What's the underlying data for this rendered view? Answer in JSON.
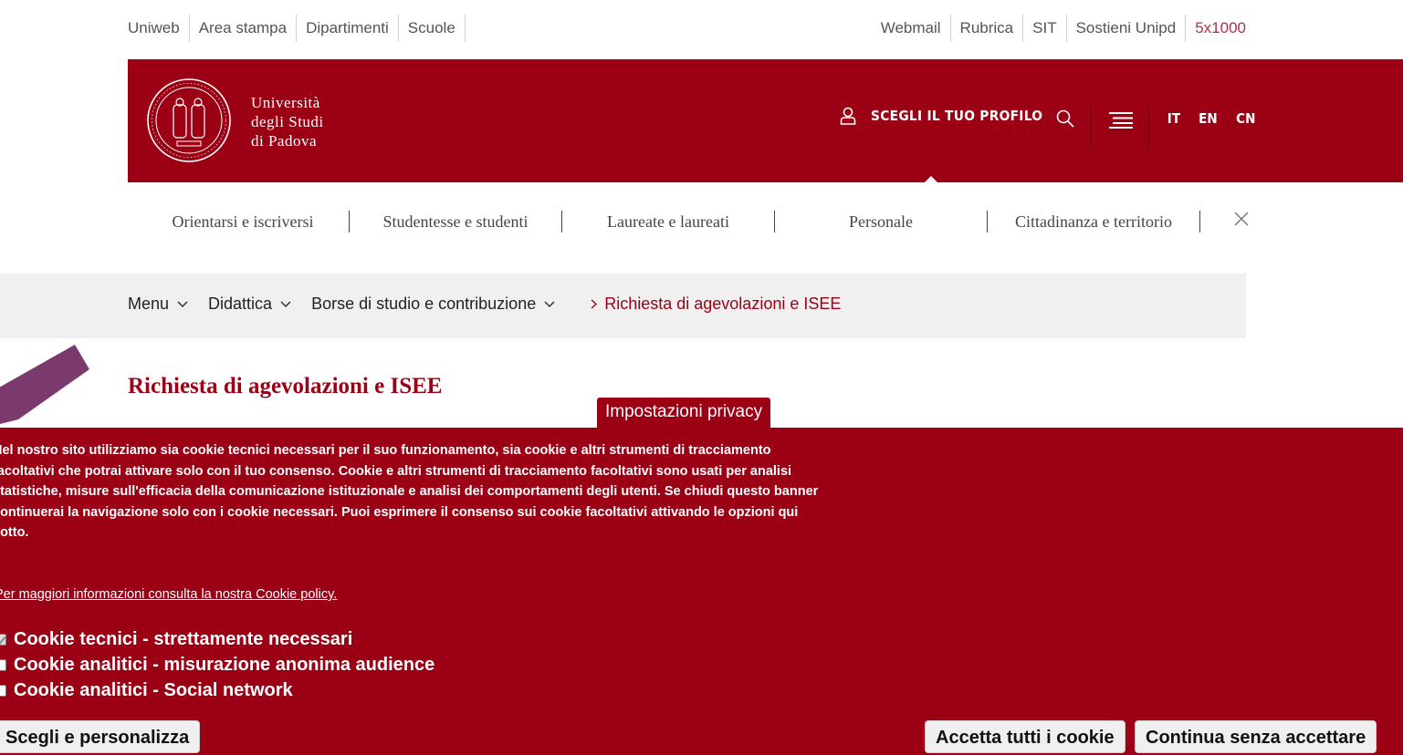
{
  "topbar": {
    "left_links": [
      "Uniweb",
      "Area stampa",
      "Dipartimenti",
      "Scuole"
    ],
    "right_links": [
      "Webmail",
      "Rubrica",
      "SIT",
      "Sostieni Unipd",
      "5x1000"
    ]
  },
  "header": {
    "logo_lines": [
      "Università",
      "degli Studi",
      "di Padova"
    ],
    "profile_label": "SCEGLI IL TUO PROFILO",
    "languages": [
      "IT",
      "EN",
      "CN"
    ]
  },
  "audience_nav": [
    "Orientarsi e iscriversi",
    "Studentesse e studenti",
    "Laureate e laureati",
    "Personale",
    "Cittadinanza e territorio"
  ],
  "breadcrumb": {
    "items": [
      "Menu",
      "Didattica",
      "Borse di studio e contribuzione"
    ],
    "current": "Richiesta di agevolazioni e ISEE"
  },
  "page": {
    "title": "Richiesta di agevolazioni e ISEE"
  },
  "cookie": {
    "tab_label": "Impostazioni privacy",
    "text": "Nel nostro sito utilizziamo sia cookie tecnici necessari per il suo funzionamento, sia cookie e altri strumenti di tracciamento facoltativi che potrai attivare solo con il tuo consenso. Cookie e altri strumenti di tracciamento facoltativi sono usati per analisi statistiche, misure sull'efficacia della comunicazione istituzionale e analisi dei comportamenti degli utenti. Se chiudi questo banner continuerai la navigazione solo con i cookie necessari. Puoi esprimere il consenso sui cookie facoltativi attivando le opzioni qui sotto.",
    "policy_link": "Per maggiori informazioni consulta la nostra Cookie policy.",
    "options": [
      {
        "label": "Cookie tecnici - strettamente necessari",
        "checked": true
      },
      {
        "label": "Cookie analitici - misurazione anonima audience",
        "checked": false
      },
      {
        "label": "Cookie analitici - Social network",
        "checked": false
      }
    ],
    "btn_customize": "Scegli e personalizza",
    "btn_accept": "Accetta tutti i cookie",
    "btn_continue": "Continua senza accettare"
  },
  "colors": {
    "brand": "#9b0014",
    "accent_link": "#b0304a",
    "deco": "#7b3a6e"
  }
}
